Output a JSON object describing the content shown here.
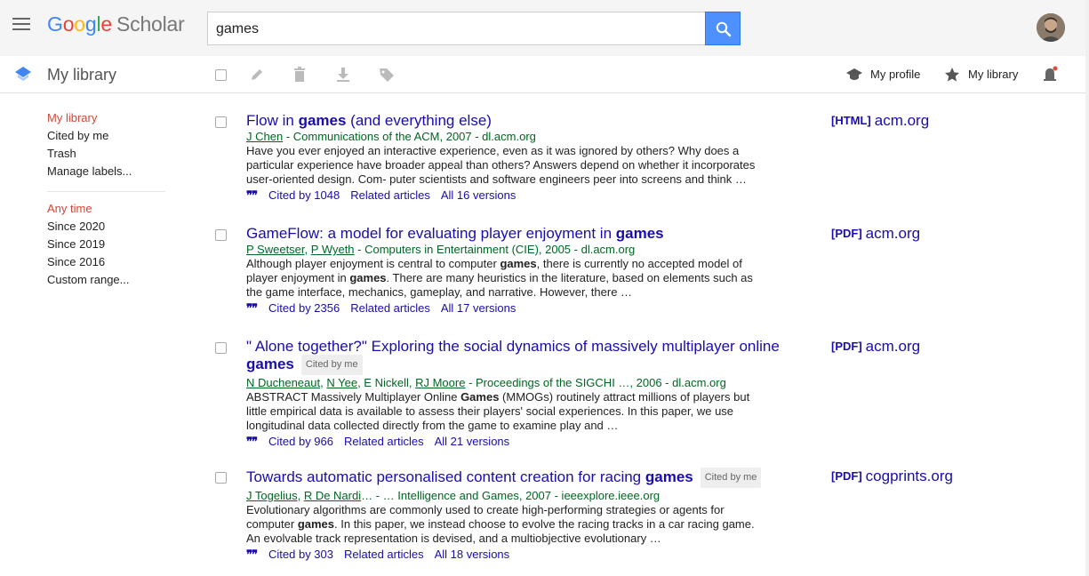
{
  "header": {
    "logo_google": [
      "G",
      "o",
      "o",
      "g",
      "l",
      "e"
    ],
    "logo_scholar": "Scholar",
    "search_value": "games"
  },
  "subbar": {
    "title": "My library",
    "my_profile": "My profile",
    "my_library": "My library"
  },
  "sidebar": {
    "items": [
      {
        "label": "My library",
        "active": true
      },
      {
        "label": "Cited by me",
        "active": false
      },
      {
        "label": "Trash",
        "active": false
      },
      {
        "label": "Manage labels...",
        "active": false
      }
    ],
    "time_filters": [
      {
        "label": "Any time",
        "active": true
      },
      {
        "label": "Since 2020",
        "active": false
      },
      {
        "label": "Since 2019",
        "active": false
      },
      {
        "label": "Since 2016",
        "active": false
      },
      {
        "label": "Custom range...",
        "active": false
      }
    ]
  },
  "results": [
    {
      "title_parts": [
        "Flow in ",
        "games",
        " (and everything else)"
      ],
      "cited_tag": "",
      "authors_links": [
        "J Chen"
      ],
      "authors_rest": " - Communications of the ACM, 2007 - dl.acm.org",
      "snippet": "Have you ever enjoyed an interactive experience, even as it was ignored by others? Why does a particular experience have broader appeal than others? Answers depend on whether it incorporates user-oriented design. Com- puter scientists and software engineers peer into screens and think …",
      "cited_by": "Cited by 1048",
      "related": "Related articles",
      "versions": "All 16 versions",
      "file_type": "[HTML]",
      "file_source": "acm.org"
    },
    {
      "title_parts": [
        "GameFlow: a model for evaluating player enjoyment in ",
        "games",
        ""
      ],
      "cited_tag": "",
      "authors_links": [
        "P Sweetser",
        "P Wyeth"
      ],
      "authors_rest": " - Computers in Entertainment (CIE), 2005 - dl.acm.org",
      "snippet": "Although player enjoyment is central to computer games, there is currently no accepted model of player enjoyment in games. There are many heuristics in the literature, based on elements such as the game interface, mechanics, gameplay, and narrative. However, there …",
      "cited_by": "Cited by 2356",
      "related": "Related articles",
      "versions": "All 17 versions",
      "file_type": "[PDF]",
      "file_source": "acm.org"
    },
    {
      "title_parts": [
        "\" Alone together?\" Exploring the social dynamics of massively multiplayer online ",
        "games",
        ""
      ],
      "cited_tag": "Cited by me",
      "authors_links": [
        "N Ducheneaut",
        "N Yee",
        "RJ Moore"
      ],
      "authors_mid": " E Nickell, ",
      "authors_rest": " - Proceedings of the SIGCHI …, 2006 - dl.acm.org",
      "snippet": "ABSTRACT Massively Multiplayer Online Games (MMOGs) routinely attract millions of players but little empirical data is available to assess their players' social experiences. In this paper, we use longitudinal data collected directly from the game to examine play and …",
      "cited_by": "Cited by 966",
      "related": "Related articles",
      "versions": "All 21 versions",
      "file_type": "[PDF]",
      "file_source": "acm.org"
    },
    {
      "title_parts": [
        "Towards automatic personalised content creation for racing ",
        "games",
        ""
      ],
      "cited_tag": "Cited by me",
      "authors_links": [
        "J Togelius",
        "R De Nardi"
      ],
      "authors_rest": "… - … Intelligence and Games, 2007 - ieeexplore.ieee.org",
      "snippet": "Evolutionary algorithms are commonly used to create high-performing strategies or agents for computer games. In this paper, we instead choose to evolve the racing tracks in a car racing game. An evolvable track representation is devised, and a multiobjective evolutionary …",
      "cited_by": "Cited by 303",
      "related": "Related articles",
      "versions": "All 18 versions",
      "file_type": "[PDF]",
      "file_source": "cogprints.org"
    }
  ],
  "colors": {
    "link": "#1a0dab",
    "green": "#006621",
    "active_red": "#d14836",
    "search_blue": "#4d90fe"
  }
}
